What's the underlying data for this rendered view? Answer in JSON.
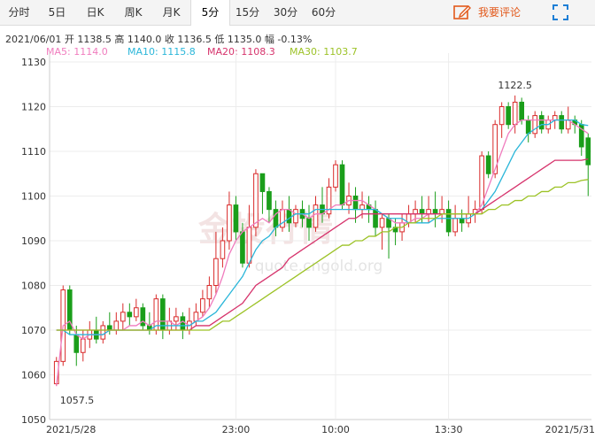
{
  "tabs": [
    {
      "label": "分时",
      "active": false
    },
    {
      "label": "5日",
      "active": false
    },
    {
      "label": "日K",
      "active": false
    },
    {
      "label": "周K",
      "active": false
    },
    {
      "label": "月K",
      "active": false
    },
    {
      "label": "5分",
      "active": true
    },
    {
      "label": "15分",
      "active": false
    },
    {
      "label": "30分",
      "active": false
    },
    {
      "label": "60分",
      "active": false
    }
  ],
  "actions": {
    "comment_label": "我要评论",
    "comment_icon": "edit-icon",
    "fullscreen_icon": "fullscreen-icon"
  },
  "info": {
    "date": "2021/06/01",
    "open_label": "开",
    "open": "1138.5",
    "high_label": "高",
    "high": "1140.0",
    "close_label": "收",
    "close": "1136.5",
    "low_label": "低",
    "low": "1135.0",
    "change_label": "幅",
    "change": "-0.13%"
  },
  "ma_labels": [
    {
      "text": "MA5: 1114.0",
      "color": "#f07cbe"
    },
    {
      "text": "MA10: 1115.8",
      "color": "#2ab6d9"
    },
    {
      "text": "MA20: 1108.3",
      "color": "#d6336c"
    },
    {
      "text": "MA30: 1103.7",
      "color": "#9cc226"
    }
  ],
  "watermark": {
    "logo_text": "金投行情",
    "url": "quote.cngold.org"
  },
  "colors": {
    "up": "#d92b2b",
    "down": "#1a9e1a",
    "grid": "#ececec"
  },
  "chart_data": {
    "type": "candlestick",
    "ylim": [
      1050,
      1130
    ],
    "y_ticks": [
      1050,
      1060,
      1070,
      1080,
      1090,
      1100,
      1110,
      1120,
      1130
    ],
    "x_labels": [
      {
        "index": 0,
        "label": "2021/5/28"
      },
      {
        "index": 27,
        "label": "23:00"
      },
      {
        "index": 42,
        "label": "10:00"
      },
      {
        "index": 59,
        "label": "13:30"
      },
      {
        "index": 80,
        "label": "2021/5/31"
      }
    ],
    "annotations": [
      {
        "text": "1057.5",
        "index": 0,
        "value": 1057.5
      },
      {
        "text": "1122.5",
        "index": 69,
        "value": 1122.5
      }
    ],
    "candles": [
      [
        1058,
        1063,
        1057.5,
        1064
      ],
      [
        1063,
        1079,
        1062,
        1080
      ],
      [
        1079,
        1070,
        1069,
        1080
      ],
      [
        1069,
        1065,
        1062,
        1071
      ],
      [
        1065,
        1068,
        1063,
        1070
      ],
      [
        1068,
        1070,
        1066,
        1072
      ],
      [
        1070,
        1068,
        1067,
        1073
      ],
      [
        1068,
        1071,
        1067,
        1072
      ],
      [
        1071,
        1070,
        1069,
        1074
      ],
      [
        1070,
        1072,
        1069,
        1074
      ],
      [
        1072,
        1074,
        1070,
        1076
      ],
      [
        1074,
        1073,
        1071,
        1076
      ],
      [
        1073,
        1075,
        1072,
        1077
      ],
      [
        1075,
        1071,
        1070,
        1076
      ],
      [
        1071,
        1070,
        1069,
        1074
      ],
      [
        1070,
        1077,
        1069,
        1078
      ],
      [
        1077,
        1070,
        1068,
        1078
      ],
      [
        1070,
        1072,
        1069,
        1075
      ],
      [
        1072,
        1073,
        1070,
        1075
      ],
      [
        1073,
        1070,
        1068,
        1074
      ],
      [
        1070,
        1072,
        1069,
        1075
      ],
      [
        1072,
        1074,
        1071,
        1076
      ],
      [
        1074,
        1077,
        1073,
        1079
      ],
      [
        1077,
        1080,
        1075,
        1082
      ],
      [
        1080,
        1086,
        1078,
        1092
      ],
      [
        1086,
        1090,
        1084,
        1093
      ],
      [
        1090,
        1098,
        1088,
        1101
      ],
      [
        1098,
        1092,
        1090,
        1100
      ],
      [
        1092,
        1085,
        1084,
        1094
      ],
      [
        1085,
        1093,
        1084,
        1098
      ],
      [
        1093,
        1105,
        1091,
        1106
      ],
      [
        1105,
        1101,
        1096,
        1103
      ],
      [
        1101,
        1097,
        1094,
        1102
      ],
      [
        1097,
        1093,
        1091,
        1099
      ],
      [
        1093,
        1097,
        1092,
        1099
      ],
      [
        1097,
        1094,
        1092,
        1100
      ],
      [
        1094,
        1097,
        1093,
        1098
      ],
      [
        1097,
        1095,
        1093,
        1099
      ],
      [
        1095,
        1093,
        1090,
        1098
      ],
      [
        1093,
        1098,
        1092,
        1100
      ],
      [
        1098,
        1096,
        1094,
        1102
      ],
      [
        1096,
        1102,
        1095,
        1104
      ],
      [
        1102,
        1107,
        1101,
        1108
      ],
      [
        1107,
        1098,
        1097,
        1108
      ],
      [
        1098,
        1100,
        1096,
        1103
      ],
      [
        1100,
        1097,
        1094,
        1102
      ],
      [
        1097,
        1098,
        1095,
        1101
      ],
      [
        1098,
        1097,
        1094,
        1100
      ],
      [
        1097,
        1093,
        1091,
        1099
      ],
      [
        1093,
        1095,
        1088,
        1096
      ],
      [
        1095,
        1093,
        1086,
        1096
      ],
      [
        1093,
        1092,
        1089,
        1095
      ],
      [
        1092,
        1094,
        1090,
        1096
      ],
      [
        1094,
        1096,
        1093,
        1098
      ],
      [
        1096,
        1097,
        1094,
        1099
      ],
      [
        1097,
        1096,
        1094,
        1100
      ],
      [
        1096,
        1097,
        1094,
        1100
      ],
      [
        1097,
        1096,
        1093,
        1101
      ],
      [
        1096,
        1097,
        1094,
        1100
      ],
      [
        1097,
        1092,
        1091,
        1099
      ],
      [
        1092,
        1095,
        1091,
        1098
      ],
      [
        1095,
        1094,
        1092,
        1097
      ],
      [
        1094,
        1096,
        1093,
        1100
      ],
      [
        1096,
        1097,
        1094,
        1099
      ],
      [
        1097,
        1109,
        1096,
        1110
      ],
      [
        1109,
        1105,
        1104,
        1110
      ],
      [
        1105,
        1116,
        1104,
        1117
      ],
      [
        1116,
        1120,
        1113,
        1121
      ],
      [
        1120,
        1116,
        1115,
        1121
      ],
      [
        1116,
        1121,
        1114,
        1122.5
      ],
      [
        1121,
        1117,
        1116,
        1122
      ],
      [
        1117,
        1114,
        1112,
        1118
      ],
      [
        1114,
        1118,
        1113,
        1119
      ],
      [
        1118,
        1115,
        1114,
        1119
      ],
      [
        1115,
        1117,
        1114,
        1118
      ],
      [
        1117,
        1118,
        1115,
        1119
      ],
      [
        1118,
        1115,
        1114,
        1119
      ],
      [
        1115,
        1117,
        1114,
        1120
      ],
      [
        1117,
        1116,
        1114,
        1118
      ],
      [
        1116,
        1111,
        1109,
        1117
      ],
      [
        1113,
        1107,
        1100,
        1114
      ]
    ],
    "ma_series": [
      {
        "name": "MA5",
        "color": "#f07cbe",
        "values": [
          1057.5,
          1071,
          1072,
          1069,
          1068,
          1069,
          1069,
          1069,
          1070,
          1070,
          1070,
          1071,
          1071,
          1072,
          1071,
          1072,
          1072,
          1072,
          1071,
          1072,
          1071,
          1072,
          1073,
          1075,
          1078,
          1082,
          1087,
          1090,
          1092,
          1093,
          1094,
          1095,
          1094,
          1096,
          1097,
          1097,
          1096,
          1096,
          1095,
          1096,
          1096,
          1097,
          1098,
          1098,
          1099,
          1099,
          1099,
          1098,
          1097,
          1096,
          1095,
          1094,
          1094,
          1094,
          1095,
          1095,
          1096,
          1096,
          1096,
          1096,
          1096,
          1096,
          1096,
          1096,
          1098,
          1102,
          1106,
          1110,
          1114,
          1116,
          1117,
          1117,
          1117,
          1117,
          1117,
          1117,
          1117,
          1117,
          1116,
          1115,
          1114
        ]
      },
      {
        "name": "MA10",
        "color": "#2ab6d9",
        "values": [
          1070,
          1070,
          1069,
          1069,
          1069,
          1069,
          1069,
          1069,
          1070,
          1070,
          1070,
          1070,
          1070,
          1070,
          1070,
          1071,
          1071,
          1071,
          1071,
          1071,
          1071,
          1072,
          1072,
          1073,
          1074,
          1076,
          1078,
          1080,
          1082,
          1085,
          1088,
          1090,
          1091,
          1093,
          1094,
          1095,
          1096,
          1096,
          1096,
          1097,
          1097,
          1097,
          1097,
          1097,
          1097,
          1097,
          1097,
          1097,
          1097,
          1096,
          1095,
          1095,
          1095,
          1094,
          1094,
          1094,
          1094,
          1095,
          1095,
          1095,
          1095,
          1095,
          1095,
          1096,
          1097,
          1099,
          1101,
          1104,
          1107,
          1110,
          1112,
          1114,
          1115,
          1116,
          1116,
          1117,
          1117,
          1117,
          1117,
          1116,
          1115.8
        ]
      },
      {
        "name": "MA20",
        "color": "#d6336c",
        "values": [
          1070,
          1070,
          1070,
          1070,
          1070,
          1070,
          1070,
          1070,
          1070,
          1070,
          1070,
          1070,
          1070,
          1070,
          1070,
          1070,
          1070,
          1070,
          1070,
          1070,
          1070,
          1071,
          1071,
          1071,
          1072,
          1073,
          1074,
          1075,
          1076,
          1078,
          1080,
          1081,
          1082,
          1083,
          1084,
          1086,
          1087,
          1088,
          1089,
          1090,
          1091,
          1092,
          1093,
          1094,
          1095,
          1095,
          1096,
          1096,
          1096,
          1096,
          1096,
          1096,
          1096,
          1096,
          1096,
          1096,
          1096,
          1096,
          1096,
          1096,
          1096,
          1096,
          1096,
          1096,
          1097,
          1098,
          1099,
          1100,
          1101,
          1102,
          1103,
          1104,
          1105,
          1106,
          1107,
          1108,
          1108,
          1108,
          1108,
          1108,
          1108.3
        ]
      },
      {
        "name": "MA30",
        "color": "#9cc226",
        "values": [
          1070,
          1070,
          1070,
          1070,
          1070,
          1070,
          1070,
          1070,
          1070,
          1070,
          1070,
          1070,
          1070,
          1070,
          1070,
          1070,
          1070,
          1070,
          1070,
          1070,
          1070,
          1070,
          1070,
          1070,
          1071,
          1072,
          1072,
          1073,
          1074,
          1075,
          1076,
          1077,
          1078,
          1079,
          1080,
          1081,
          1082,
          1083,
          1084,
          1085,
          1086,
          1087,
          1088,
          1089,
          1089,
          1090,
          1090,
          1091,
          1091,
          1092,
          1092,
          1093,
          1093,
          1094,
          1094,
          1095,
          1095,
          1095,
          1096,
          1096,
          1096,
          1096,
          1096,
          1096,
          1096,
          1097,
          1097,
          1098,
          1098,
          1099,
          1099,
          1100,
          1100,
          1101,
          1101,
          1102,
          1102,
          1103,
          1103,
          1103.5,
          1103.7
        ]
      }
    ]
  }
}
